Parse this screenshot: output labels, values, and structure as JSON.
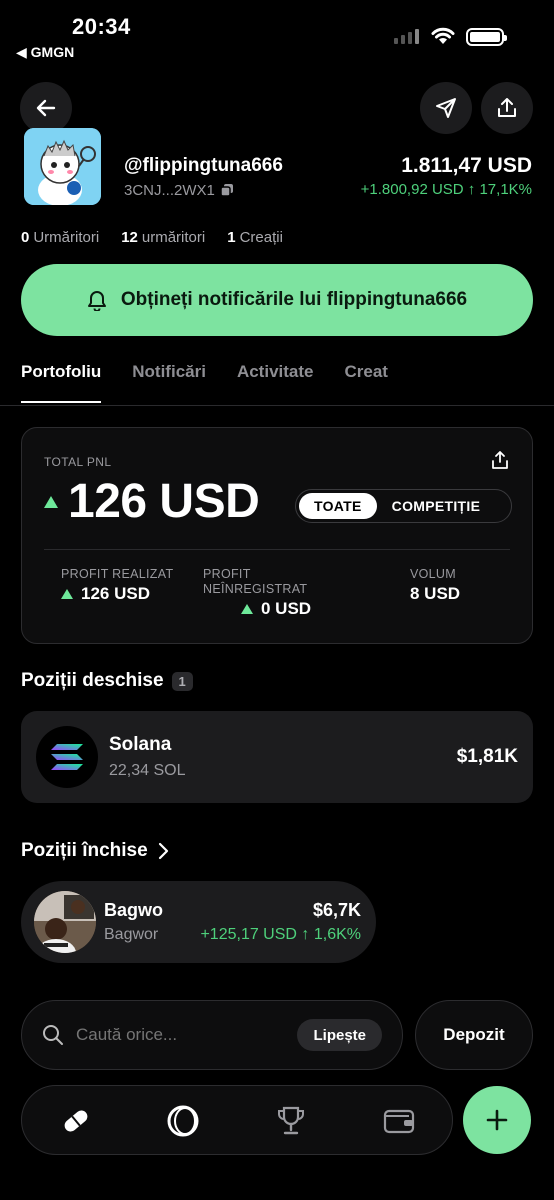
{
  "status_bar": {
    "time": "20:34",
    "back_app": "◀ GMGN"
  },
  "profile": {
    "handle": "@flippingtuna666",
    "address": "3CNJ...2WX1",
    "balance": "1.811,47 USD",
    "balance_change": "+1.800,92 USD ↑ 17,1K%"
  },
  "stats": {
    "followers_count": "0",
    "followers_label": "Urmăritori",
    "following_count": "12",
    "following_label": "urmăritori",
    "created_count": "1",
    "created_label": "Creații"
  },
  "notify_button": {
    "label": "Obțineți notificările lui flippingtuna666"
  },
  "tabs": [
    {
      "label": "Portofoliu",
      "active": true
    },
    {
      "label": "Notificări",
      "active": false
    },
    {
      "label": "Activitate",
      "active": false
    },
    {
      "label": "Creat",
      "active": false
    }
  ],
  "pnl": {
    "label": "TOTAL PNL",
    "value": "126 USD",
    "segments": [
      "TOATE",
      "COMPETIȚIE"
    ],
    "realized_label": "PROFIT REALIZAT",
    "realized_value": "126 USD",
    "unrealized_label_1": "PROFIT",
    "unrealized_label_2": "NEÎNREGISTRAT",
    "unrealized_value": "0 USD",
    "volume_label": "VOLUM",
    "volume_value": "8 USD"
  },
  "open_positions": {
    "title": "Poziții deschise",
    "count": "1",
    "items": [
      {
        "name": "Solana",
        "amount": "22,34 SOL",
        "value": "$1,81K"
      }
    ]
  },
  "closed_positions": {
    "title": "Poziții închise",
    "items": [
      {
        "name": "Bagwo",
        "sub": "Bagwor",
        "value": "$6,7K",
        "change": "+125,17 USD ↑ 1,6K%"
      }
    ]
  },
  "search": {
    "placeholder": "Caută orice...",
    "paste_label": "Lipește"
  },
  "deposit_label": "Depozit",
  "colors": {
    "accent": "#7de3a0",
    "positive": "#4ed07b",
    "card": "#1c1c1e"
  }
}
